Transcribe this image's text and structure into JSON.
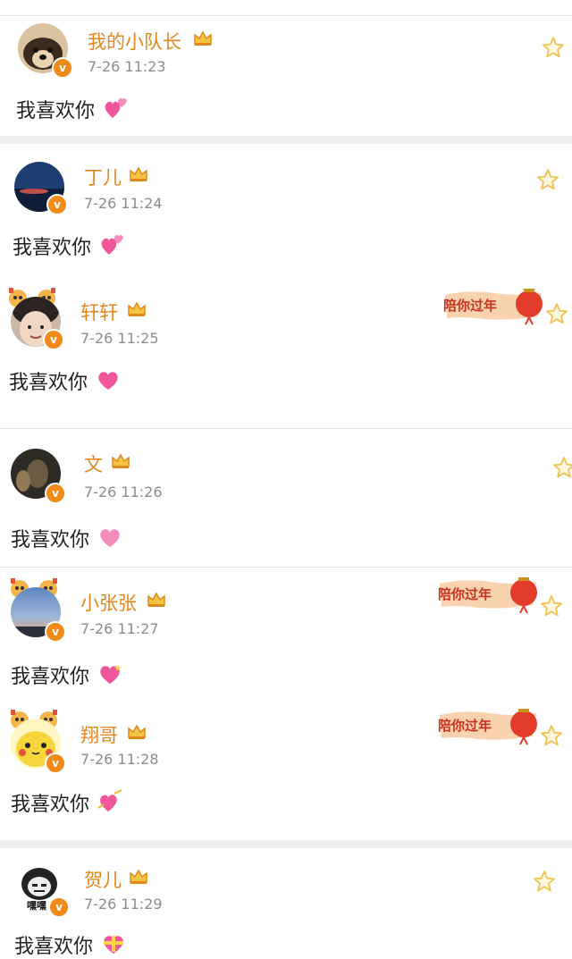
{
  "comments": [
    {
      "name": "我的小队长",
      "time": "7-26 11:23",
      "text": "我喜欢你",
      "verified": "v"
    },
    {
      "name": "丁儿",
      "time": "7-26 11:24",
      "text": "我喜欢你",
      "verified": "v"
    },
    {
      "name": "轩轩",
      "time": "7-26 11:25",
      "text": "我喜欢你",
      "verified": "v",
      "sticker": "陪你过年"
    },
    {
      "name": "文",
      "time": "7-26 11:26",
      "text": "我喜欢你",
      "verified": "v"
    },
    {
      "name": "小张张",
      "time": "7-26 11:27",
      "text": "我喜欢你",
      "verified": "v",
      "sticker": "陪你过年"
    },
    {
      "name": "翔哥",
      "time": "7-26 11:28",
      "text": "我喜欢你",
      "verified": "v",
      "sticker": "陪你过年"
    },
    {
      "name": "贺儿",
      "time": "7-26 11:29",
      "text": "我喜欢你",
      "verified": "v",
      "avatar_caption": "嘿嘿"
    }
  ],
  "icons": {
    "favorite": "star-outline-icon",
    "member": "crown-icon",
    "verified": "verified-v-icon",
    "emoji": "heart-emoji-icon"
  },
  "colors": {
    "username": "#e3861c",
    "timestamp": "#8c8c8c",
    "verified_badge": "#f08a18",
    "separator": "#efefef",
    "heart": "#f0569a",
    "star": "#f2c250"
  }
}
